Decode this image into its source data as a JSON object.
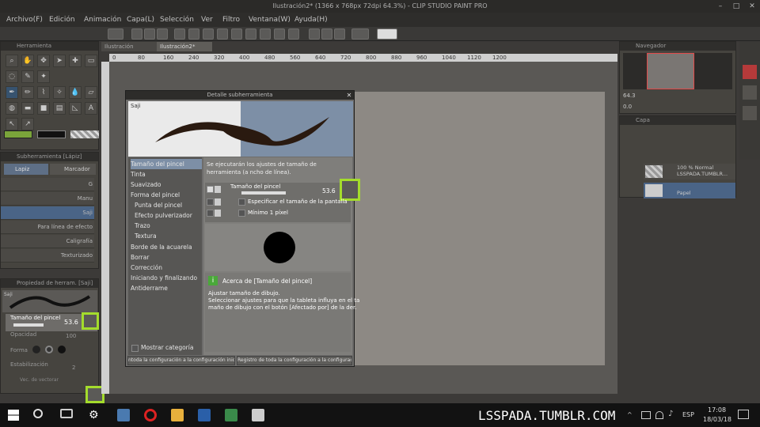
{
  "window": {
    "title": "Ilustración2* (1366 x 768px 72dpi 64.3%) - CLIP STUDIO PAINT PRO"
  },
  "menu": [
    "Archivo(F)",
    "Edición",
    "Animación",
    "Capa(L)",
    "Selección",
    "Ver",
    "Filtro",
    "Ventana(W)",
    "Ayuda(H)"
  ],
  "tabs": [
    "Ilustración",
    "Ilustración2*"
  ],
  "ruler_ticks": [
    "0",
    "80",
    "160",
    "240",
    "320",
    "400",
    "480",
    "560",
    "640",
    "720",
    "800",
    "880",
    "960",
    "1040",
    "1120",
    "1200"
  ],
  "panels": {
    "tool": "Herramienta",
    "subtool": "Subherramienta [Lápiz]",
    "subtool_tabs": [
      "Lapiz",
      "Marcador"
    ],
    "brushes": [
      "G",
      "Manu",
      "Saji",
      "Para línea de efecto",
      "Caligrafía",
      "Texturizado"
    ],
    "property": "Propiedad de herram. [Saji]",
    "property_brush": "Saji",
    "property_rows": {
      "size_label": "Tamaño del pincel",
      "size_value": "53.6",
      "opacity": "Opacidad",
      "opacity_value": "100",
      "shape": "Forma",
      "stab": "Estabilización",
      "stab_value": "2",
      "vector": "Vec. de vectorar"
    },
    "navigator": "Navegador",
    "nav_zoom": "64.3",
    "nav_rot": "0.0",
    "layer": "Capa",
    "layers": [
      {
        "name": "100 % Normal",
        "sub": "LSSPADA.TUMBLR..."
      },
      {
        "name": "Papel",
        "sub": ""
      }
    ]
  },
  "dialog": {
    "title": "Detalle subherramienta",
    "preview_label": "Saji",
    "categories": [
      "Tamaño del pincel",
      "Tinta",
      "Suavizado",
      "Forma del pincel",
      "Punta del pincel",
      "Efecto pulverizador",
      "Trazo",
      "Textura",
      "Borde de la acuarela",
      "Borrar",
      "Corrección",
      "Iniciando y finalizando",
      "Antiderrame"
    ],
    "show_category": "Mostrar categoría",
    "description": "Se ejecutarán los ajustes de tamaño de herramienta (a ncho de línea).",
    "size_label": "Tamaño del pincel",
    "size_value": "53.6",
    "opt1": "Especificar el tamaño de la pantalla",
    "opt2": "Mínimo 1 píxel",
    "about_title": "Acerca de [Tamaño del pincel]",
    "about_l1": "Ajustar tamaño de dibujo.",
    "about_l2": "Seleccionar ajustes para que la tableta influya en el ta",
    "about_l3": "maño de dibujo con el botón [Afectado por] de la der.",
    "btn_reset": "ntoda la configuración a la configuración inicial",
    "btn_save": "Registro de toda la configuración a la configuración inicial"
  },
  "taskbar": {
    "watermark": "LSSPADA.TUMBLR.COM",
    "time": "17:08",
    "date": "18/03/18",
    "lang": "ESP"
  },
  "colors": {
    "accent": "#a6d92a",
    "selected": "#7d8fa6"
  }
}
